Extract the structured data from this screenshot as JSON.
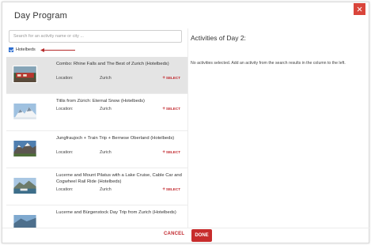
{
  "dialog": {
    "title": "Day Program",
    "close_icon": "×"
  },
  "search": {
    "placeholder": "Search for an activity name or city ..."
  },
  "filter": {
    "label": "Hotelbeds",
    "checked": true
  },
  "right": {
    "title": "Activities of Day 2:",
    "empty_message": "No activities selected. Add an activity from the search results in the column to the left."
  },
  "activities": [
    {
      "title": "Combo: Rhine Falls and The Best of Zurich (Hotelbeds)",
      "location_label": "Location:",
      "location": "Zurich",
      "select_label": "SELECT",
      "selected": true
    },
    {
      "title": "Titlis from Zürich: Eternal Snow (Hotelbeds)",
      "location_label": "Location:",
      "location": "Zurich",
      "select_label": "SELECT"
    },
    {
      "title": "Jungfraujoch + Train Trip + Bernese Oberland (Hotelbeds)",
      "location_label": "Location:",
      "location": "Zurich",
      "select_label": "SELECT"
    },
    {
      "title": "Lucerne and Mount Pilatus with a Lake Cruise, Cable Car and Cogwheel Rail Ride (Hotelbeds)",
      "location_label": "Location:",
      "location": "Zurich",
      "select_label": "SELECT"
    },
    {
      "title": "Lucerne and Bürgenstock Day Trip from Zurich (Hotelbeds)"
    }
  ],
  "footer": {
    "cancel_label": "CANCEL",
    "done_label": "DONE"
  },
  "colors": {
    "accent": "#c72c2c",
    "checkbox": "#2f6fd1"
  }
}
